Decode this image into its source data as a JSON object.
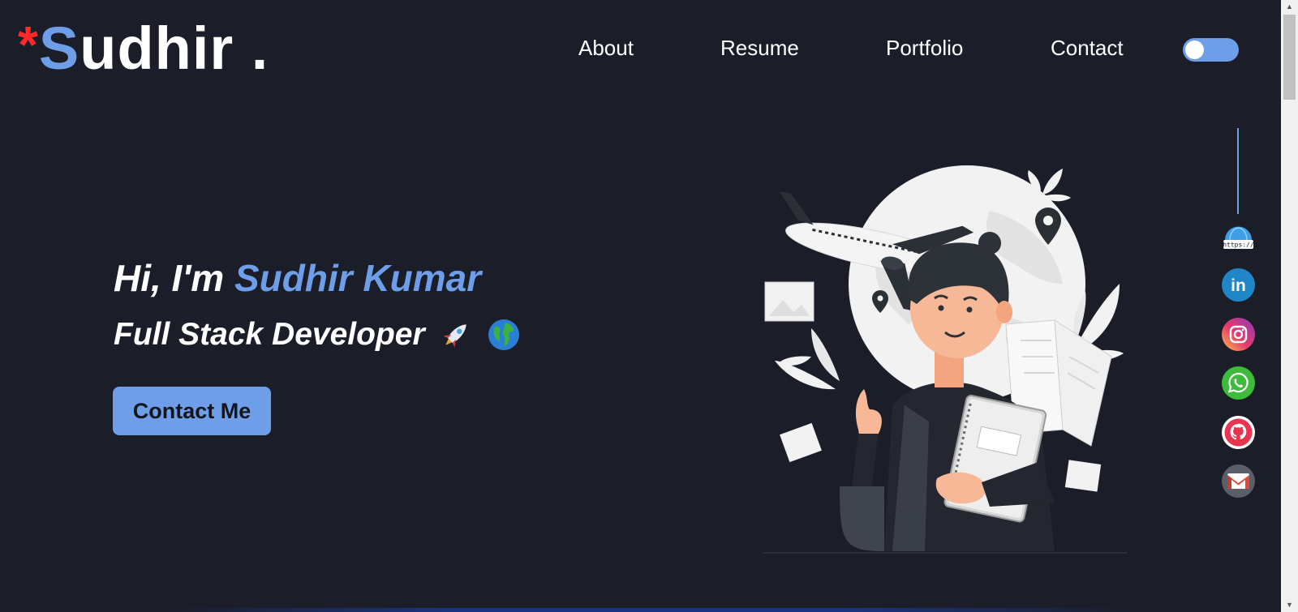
{
  "logo": {
    "asterisk": "*",
    "first_letter": "S",
    "rest": "udhir ."
  },
  "nav": {
    "items": [
      {
        "label": "About"
      },
      {
        "label": "Resume"
      },
      {
        "label": "Portfolio"
      },
      {
        "label": "Contact"
      }
    ],
    "theme_toggle": {
      "state": "off"
    }
  },
  "hero": {
    "greeting_prefix": "Hi, I'm ",
    "name": "Sudhir Kumar",
    "role": "Full Stack Developer",
    "role_emojis": [
      "rocket",
      "globe"
    ],
    "cta_label": "Contact Me"
  },
  "social": [
    {
      "icon": "website-icon",
      "text": "https://"
    },
    {
      "icon": "linkedin-icon",
      "text": "in"
    },
    {
      "icon": "instagram-icon"
    },
    {
      "icon": "whatsapp-icon"
    },
    {
      "icon": "github-icon"
    },
    {
      "icon": "gmail-icon"
    }
  ],
  "colors": {
    "background": "#1b1e28",
    "accent": "#6e9ee8",
    "logo_asterisk": "#ff2a2a"
  }
}
